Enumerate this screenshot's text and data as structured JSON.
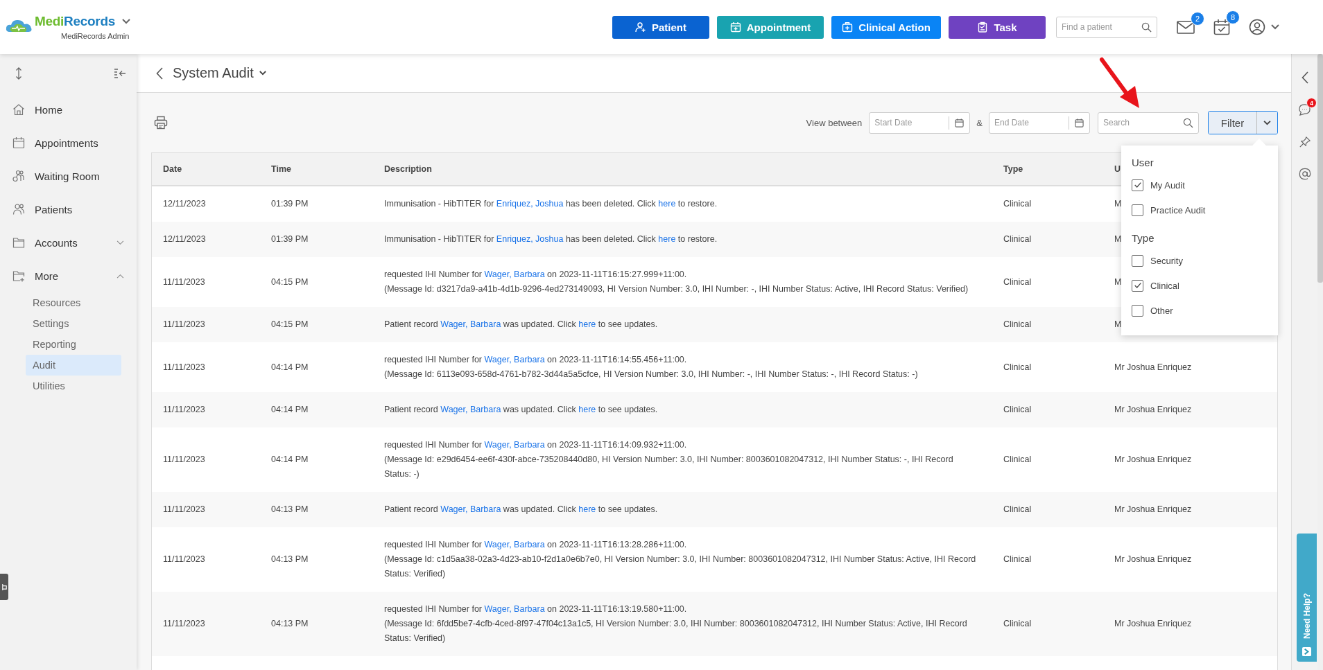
{
  "brand": {
    "parts": [
      "Medi",
      "Records"
    ],
    "subtitle": "MediRecords Admin"
  },
  "actions": [
    {
      "label": "Patient",
      "kind": "patient"
    },
    {
      "label": "Appointment",
      "kind": "appointment"
    },
    {
      "label": "Clinical Action",
      "kind": "clinical"
    },
    {
      "label": "Task",
      "kind": "task"
    }
  ],
  "patient_search": {
    "placeholder": "Find a patient"
  },
  "notifications": [
    {
      "kind": "mail",
      "count": "2"
    },
    {
      "kind": "calendar",
      "count": "8"
    }
  ],
  "sidebar": {
    "items": [
      {
        "label": "Home",
        "kind": "home",
        "selected": false
      },
      {
        "label": "Appointments",
        "kind": "appointments",
        "selected": false
      },
      {
        "label": "Waiting Room",
        "kind": "waiting",
        "selected": false
      },
      {
        "label": "Patients",
        "kind": "patients",
        "selected": false
      },
      {
        "label": "Accounts",
        "kind": "accounts",
        "selected": false,
        "expanded": false
      },
      {
        "label": "More",
        "kind": "more",
        "selected": false,
        "expanded": true,
        "children": [
          {
            "label": "Resources",
            "selected": false
          },
          {
            "label": "Settings",
            "selected": false
          },
          {
            "label": "Reporting",
            "selected": false
          },
          {
            "label": "Audit",
            "selected": true
          },
          {
            "label": "Utilities",
            "selected": false
          }
        ]
      }
    ]
  },
  "page": {
    "title": "System Audit"
  },
  "toolbar": {
    "view_between": "View between",
    "start_date": {
      "placeholder": "Start Date"
    },
    "separator": "&",
    "end_date": {
      "placeholder": "End Date"
    },
    "search": {
      "placeholder": "Search"
    },
    "filter": "Filter"
  },
  "filter_menu": {
    "groups": [
      {
        "title": "User",
        "options": [
          {
            "label": "My Audit",
            "checked": true
          },
          {
            "label": "Practice Audit",
            "checked": false
          }
        ]
      },
      {
        "title": "Type",
        "options": [
          {
            "label": "Security",
            "checked": false
          },
          {
            "label": "Clinical",
            "checked": true
          },
          {
            "label": "Other",
            "checked": false
          }
        ]
      }
    ]
  },
  "table": {
    "columns": [
      "Date",
      "Time",
      "Description",
      "Type",
      "U"
    ],
    "rows": [
      {
        "date": "12/11/2023",
        "time": "01:39 PM",
        "description": [
          [
            {
              "text": "Immunisation - HibTITER for "
            },
            {
              "text": "Enriquez, Joshua",
              "link": true
            },
            {
              "text": " has been deleted. Click "
            },
            {
              "text": "here",
              "link": true
            },
            {
              "text": " to restore."
            }
          ]
        ],
        "type": "Clinical",
        "user": "M"
      },
      {
        "date": "12/11/2023",
        "time": "01:39 PM",
        "description": [
          [
            {
              "text": "Immunisation - HibTITER for "
            },
            {
              "text": "Enriquez, Joshua",
              "link": true
            },
            {
              "text": " has been deleted. Click "
            },
            {
              "text": "here",
              "link": true
            },
            {
              "text": " to restore."
            }
          ]
        ],
        "type": "Clinical",
        "user": "M"
      },
      {
        "date": "11/11/2023",
        "time": "04:15 PM",
        "description": [
          [
            {
              "text": "requested IHI Number for "
            },
            {
              "text": "Wager, Barbara",
              "link": true
            },
            {
              "text": " on 2023-11-11T16:15:27.999+11:00."
            }
          ],
          [
            {
              "text": "(Message Id: d3217da9-a41b-4d1b-9296-4ed273149093, HI Version Number: 3.0, IHI Number: -, IHI Number Status: Active, IHI Record Status: Verified)"
            }
          ]
        ],
        "type": "Clinical",
        "user": "M"
      },
      {
        "date": "11/11/2023",
        "time": "04:15 PM",
        "description": [
          [
            {
              "text": "Patient record "
            },
            {
              "text": "Wager, Barbara",
              "link": true
            },
            {
              "text": " was updated. Click "
            },
            {
              "text": "here",
              "link": true
            },
            {
              "text": " to see updates."
            }
          ]
        ],
        "type": "Clinical",
        "user": "M"
      },
      {
        "date": "11/11/2023",
        "time": "04:14 PM",
        "description": [
          [
            {
              "text": "requested IHI Number for "
            },
            {
              "text": "Wager, Barbara",
              "link": true
            },
            {
              "text": " on 2023-11-11T16:14:55.456+11:00."
            }
          ],
          [
            {
              "text": "(Message Id: 6113e093-658d-4761-b782-3d44a5a5cfce, HI Version Number: 3.0, IHI Number: -, IHI Number Status: -, IHI Record Status: -)"
            }
          ]
        ],
        "type": "Clinical",
        "user": "Mr Joshua Enriquez"
      },
      {
        "date": "11/11/2023",
        "time": "04:14 PM",
        "description": [
          [
            {
              "text": "Patient record "
            },
            {
              "text": "Wager, Barbara",
              "link": true
            },
            {
              "text": " was updated. Click "
            },
            {
              "text": "here",
              "link": true
            },
            {
              "text": " to see updates."
            }
          ]
        ],
        "type": "Clinical",
        "user": "Mr Joshua Enriquez"
      },
      {
        "date": "11/11/2023",
        "time": "04:14 PM",
        "description": [
          [
            {
              "text": "requested IHI Number for "
            },
            {
              "text": "Wager, Barbara",
              "link": true
            },
            {
              "text": " on 2023-11-11T16:14:09.932+11:00."
            }
          ],
          [
            {
              "text": "(Message Id: e29d6454-ee6f-430f-abce-735208440d80, HI Version Number: 3.0, IHI Number: 8003601082047312, IHI Number Status: -, IHI Record Status: -)"
            }
          ]
        ],
        "type": "Clinical",
        "user": "Mr Joshua Enriquez"
      },
      {
        "date": "11/11/2023",
        "time": "04:13 PM",
        "description": [
          [
            {
              "text": "Patient record "
            },
            {
              "text": "Wager, Barbara",
              "link": true
            },
            {
              "text": " was updated. Click "
            },
            {
              "text": "here",
              "link": true
            },
            {
              "text": " to see updates."
            }
          ]
        ],
        "type": "Clinical",
        "user": "Mr Joshua Enriquez"
      },
      {
        "date": "11/11/2023",
        "time": "04:13 PM",
        "description": [
          [
            {
              "text": "requested IHI Number for "
            },
            {
              "text": "Wager, Barbara",
              "link": true
            },
            {
              "text": " on 2023-11-11T16:13:28.286+11:00."
            }
          ],
          [
            {
              "text": "(Message Id: c1d5aa38-02a3-4d23-ab10-f2d1a0e6b7e0, HI Version Number: 3.0, IHI Number: 8003601082047312, IHI Number Status: Active, IHI Record Status: Verified)"
            }
          ]
        ],
        "type": "Clinical",
        "user": "Mr Joshua Enriquez"
      },
      {
        "date": "11/11/2023",
        "time": "04:13 PM",
        "description": [
          [
            {
              "text": "requested IHI Number for "
            },
            {
              "text": "Wager, Barbara",
              "link": true
            },
            {
              "text": " on 2023-11-11T16:13:19.580+11:00."
            }
          ],
          [
            {
              "text": "(Message Id: 6fdd5be7-4cfb-4ced-8f97-47f04c13a1c5, HI Version Number: 3.0, IHI Number: 8003601082047312, IHI Number Status: Active, IHI Record Status: Verified)"
            }
          ]
        ],
        "type": "Clinical",
        "user": "Mr Joshua Enriquez"
      }
    ]
  },
  "right_rail": {
    "chat_badge": "4"
  },
  "help_tab": {
    "label": "Need Help?"
  }
}
